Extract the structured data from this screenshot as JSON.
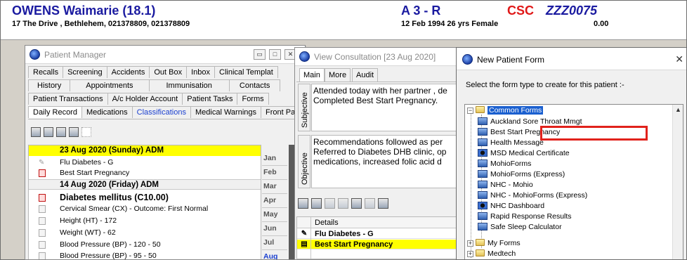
{
  "patient": {
    "name": "OWENS Waimarie (18.1)",
    "address": "17 The Drive , Bethlehem, 021378809, 021378809",
    "location": "A 3 - R",
    "dob": "12 Feb 1994 26 yrs   Female",
    "csc": "CSC",
    "nhi": "ZZZ0075",
    "balance": "0.00"
  },
  "patient_manager": {
    "title": "Patient Manager",
    "tabs_row1": [
      "Recalls",
      "Screening",
      "Accidents",
      "Out Box",
      "Inbox",
      "Clinical Templat"
    ],
    "tabs_row2": [
      "History",
      "Appointments",
      "Immunisation",
      "Contacts"
    ],
    "tabs_row3": [
      "Patient Transactions",
      "A/c Holder Account",
      "Patient Tasks",
      "Forms"
    ],
    "tabs_row4": [
      "Daily Record",
      "Medications",
      "Classifications",
      "Medical Warnings",
      "Front Pag"
    ],
    "records": [
      {
        "text": "23 Aug 2020 (Sunday) ADM",
        "kind": "hl"
      },
      {
        "text": "Flu Diabetes - G",
        "kind": "item",
        "icon": "pen"
      },
      {
        "text": "Best Start Pregnancy",
        "kind": "item",
        "icon": "red"
      },
      {
        "text": "14 Aug 2020 (Friday) ADM",
        "kind": "date"
      },
      {
        "text": "Diabetes mellitus (C10.00)",
        "kind": "big",
        "icon": "red"
      },
      {
        "text": "Cervical Smear (CX) - Outcome: First Normal",
        "kind": "item",
        "icon": "doc"
      },
      {
        "text": "Height (HT) - 172",
        "kind": "item",
        "icon": "doc"
      },
      {
        "text": "Weight (WT) - 62",
        "kind": "item",
        "icon": "doc"
      },
      {
        "text": "Blood Pressure (BP) - 120 - 50",
        "kind": "item",
        "icon": "doc"
      },
      {
        "text": "Blood Pressure (BP) - 95 - 50",
        "kind": "item",
        "icon": "doc"
      }
    ],
    "months": [
      "Jan",
      "Feb",
      "Mar",
      "Apr",
      "May",
      "Jun",
      "Jul",
      "Aug"
    ]
  },
  "view_consultation": {
    "title": "View Consultation [23 Aug 2020]",
    "tabs": [
      "Main",
      "More",
      "Audit"
    ],
    "subjective_label": "Subjective",
    "subjective_lines": [
      "Attended today with her partner , de",
      "Completed Best Start Pregnancy."
    ],
    "objective_label": "Objective",
    "objective_lines": [
      "Recommendations followed as per",
      "Referred to Diabetes DHB clinic, op",
      "medications, increased folic acid d"
    ],
    "grid_header": "Details",
    "grid_rows": [
      {
        "text": "Flu Diabetes - G",
        "highlight": false
      },
      {
        "text": "Best Start Pregnancy",
        "highlight": true
      }
    ]
  },
  "new_patient_form": {
    "title": "New Patient Form",
    "close": "✕",
    "prompt": "Select the form type to create for this patient :-",
    "root": "Common Forms",
    "forms": [
      "Auckland Sore Throat Mmgt",
      "Best Start Pregnancy",
      "Health Message",
      "MSD Medical Certificate",
      "MohioForms",
      "MohioForms (Express)",
      "NHC - Mohio",
      "NHC - MohioForms (Express)",
      "NHC Dashboard",
      "Rapid Response Results",
      "Safe Sleep Calculator"
    ],
    "other_folders": [
      "My Forms",
      "Medtech"
    ],
    "selected_form": "Best Start Pregnancy"
  }
}
